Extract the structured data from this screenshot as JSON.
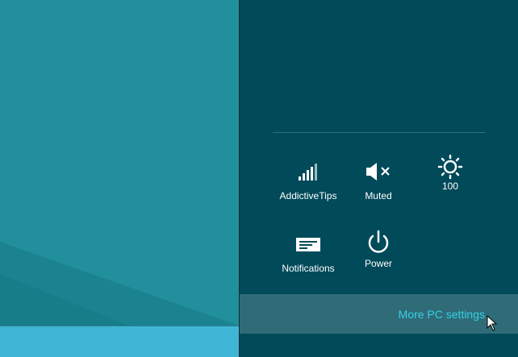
{
  "colors": {
    "desktop": "#22909c",
    "taskbar": "#3fb6d6",
    "charm": "#004a5a",
    "more_settings_bg": "#2f6c78",
    "link": "#35d0e6"
  },
  "quick_settings": [
    {
      "label": "AddictiveTips",
      "icon": "wifi-signal-icon"
    },
    {
      "label": "Muted",
      "icon": "speaker-muted-icon"
    },
    {
      "label": "100",
      "icon": "brightness-icon"
    },
    {
      "label": "Notifications",
      "icon": "notifications-icon"
    },
    {
      "label": "Power",
      "icon": "power-icon"
    }
  ],
  "more_settings": {
    "label": "More PC settings"
  }
}
